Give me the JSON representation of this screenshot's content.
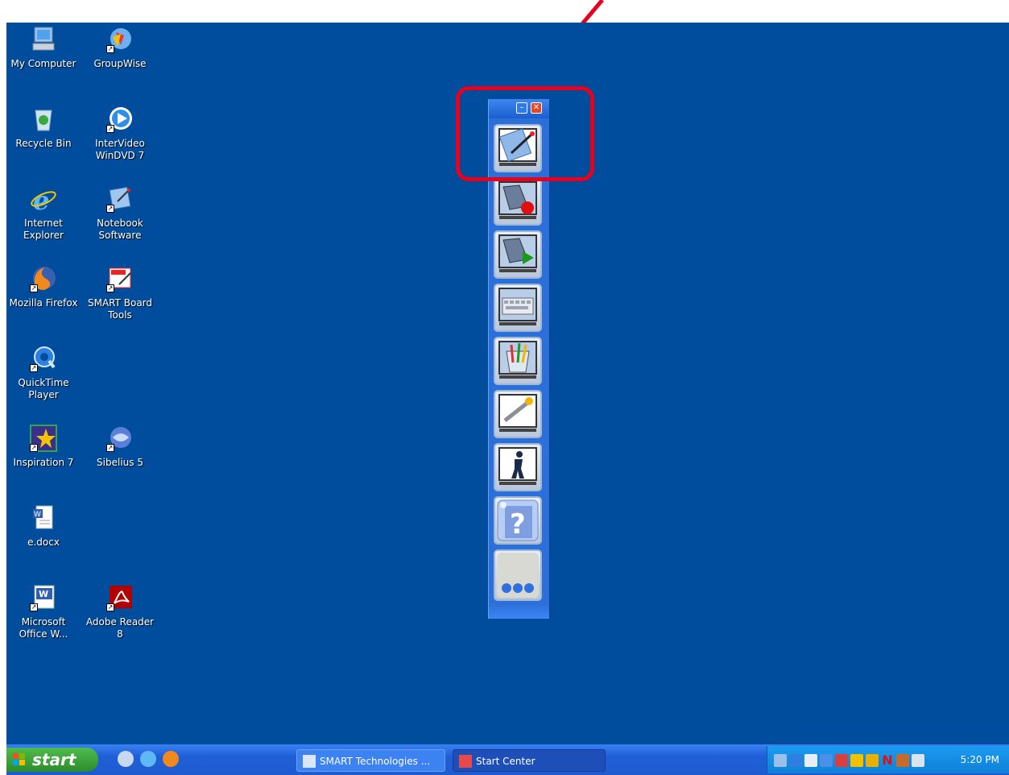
{
  "desktop": {
    "icons": [
      {
        "label": "My Computer",
        "icon": "my-computer-icon"
      },
      {
        "label": "GroupWise",
        "icon": "groupwise-icon"
      },
      {
        "label": "Recycle Bin",
        "icon": "recycle-bin-icon"
      },
      {
        "label": "InterVideo WinDVD 7",
        "icon": "windvd-icon"
      },
      {
        "label": "Internet Explorer",
        "icon": "internet-explorer-icon"
      },
      {
        "label": "Notebook Software",
        "icon": "notebook-software-icon"
      },
      {
        "label": "Mozilla Firefox",
        "icon": "firefox-icon"
      },
      {
        "label": "SMART Board Tools",
        "icon": "smart-board-tools-icon"
      },
      {
        "label": "QuickTime Player",
        "icon": "quicktime-icon"
      },
      {
        "label": "Inspiration 7",
        "icon": "inspiration-icon"
      },
      {
        "label": "Sibelius 5",
        "icon": "sibelius-icon"
      },
      {
        "label": "e.docx",
        "icon": "word-document-icon"
      },
      {
        "label": "Microsoft Office W...",
        "icon": "microsoft-word-icon"
      },
      {
        "label": "Adobe Reader 8",
        "icon": "adobe-reader-icon"
      }
    ]
  },
  "smart_toolbar": {
    "minimize_label": "–",
    "close_label": "✕",
    "tools": [
      {
        "name": "notebook-tool",
        "icon": "notebook-icon"
      },
      {
        "name": "recorder-tool",
        "icon": "recorder-icon"
      },
      {
        "name": "video-player-tool",
        "icon": "video-player-icon"
      },
      {
        "name": "keyboard-tool",
        "icon": "keyboard-icon"
      },
      {
        "name": "floating-tools",
        "icon": "pen-tray-icon"
      },
      {
        "name": "control-panel-tool",
        "icon": "wrench-icon"
      },
      {
        "name": "orient-tool",
        "icon": "orient-icon"
      },
      {
        "name": "help-tool",
        "icon": "help-icon"
      },
      {
        "name": "more-tool",
        "icon": "more-dots-icon"
      }
    ]
  },
  "annotation": {
    "highlight_color": "#e8001c",
    "arrow_color": "#e8001c"
  },
  "taskbar": {
    "start_label": "start",
    "quick_launch": [
      "settings-icon",
      "internet-explorer-icon",
      "firefox-icon"
    ],
    "tasks": [
      {
        "label": "SMART Technologies ...",
        "icon": "smart-icon"
      },
      {
        "label": "Start Center",
        "icon": "start-center-icon"
      }
    ],
    "tray_icons": [
      "network-icon",
      "volume-icon",
      "chart-icon",
      "pen-icon",
      "arrow-icon",
      "pencil-icon",
      "mail-icon",
      "n-icon",
      "gear-icon",
      "flag-icon"
    ],
    "clock": "5:20 PM"
  },
  "colors": {
    "desktop_bg": "#004d9e",
    "taskbar_bg": "#1f5fd6",
    "start_green": "#3aa338"
  }
}
